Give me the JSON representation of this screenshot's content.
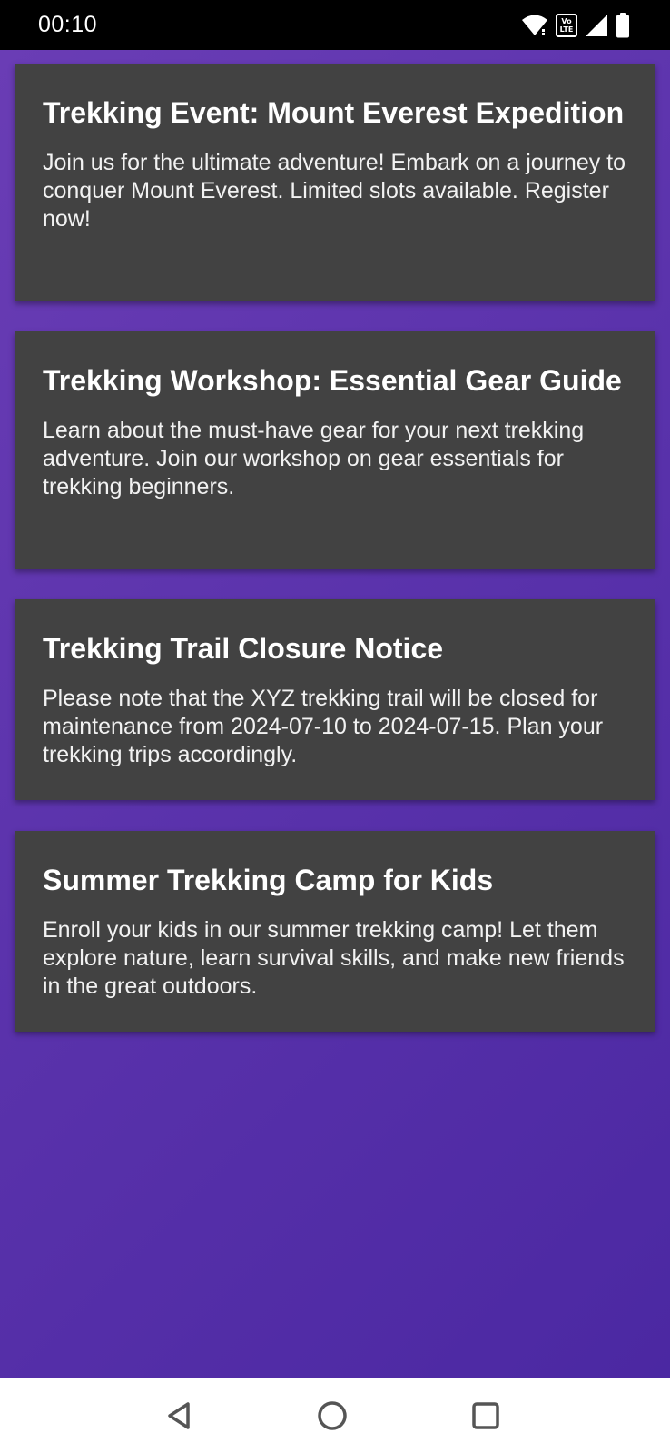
{
  "status_bar": {
    "time": "00:10",
    "icons": [
      "wifi-icon",
      "volte-lte-icon",
      "cell-signal-icon",
      "battery-icon"
    ],
    "lte_top": "Vo",
    "lte_bottom": "LTE"
  },
  "colors": {
    "background_gradient_start": "#6a3db5",
    "background_gradient_end": "#4b28a2",
    "card_background": "#424242",
    "text": "#ffffff"
  },
  "cards": [
    {
      "title": "Trekking Event: Mount Everest Expedition",
      "body": "Join us for the ultimate adventure! Embark on a journey to conquer Mount Everest. Limited slots available. Register now!"
    },
    {
      "title": "Trekking Workshop: Essential Gear Guide",
      "body": "Learn about the must-have gear for your next trekking adventure. Join our workshop on gear essentials for trekking beginners."
    },
    {
      "title": "Trekking Trail Closure Notice",
      "body": "Please note that the XYZ trekking trail will be closed for maintenance from 2024-07-10 to 2024-07-15. Plan your trekking trips accordingly."
    },
    {
      "title": "Summer Trekking Camp for Kids",
      "body": "Enroll your kids in our summer trekking camp! Let them explore nature, learn survival skills, and make new friends in the great outdoors."
    }
  ],
  "nav_bar": {
    "buttons": [
      "back-icon",
      "home-icon",
      "recents-icon"
    ]
  }
}
